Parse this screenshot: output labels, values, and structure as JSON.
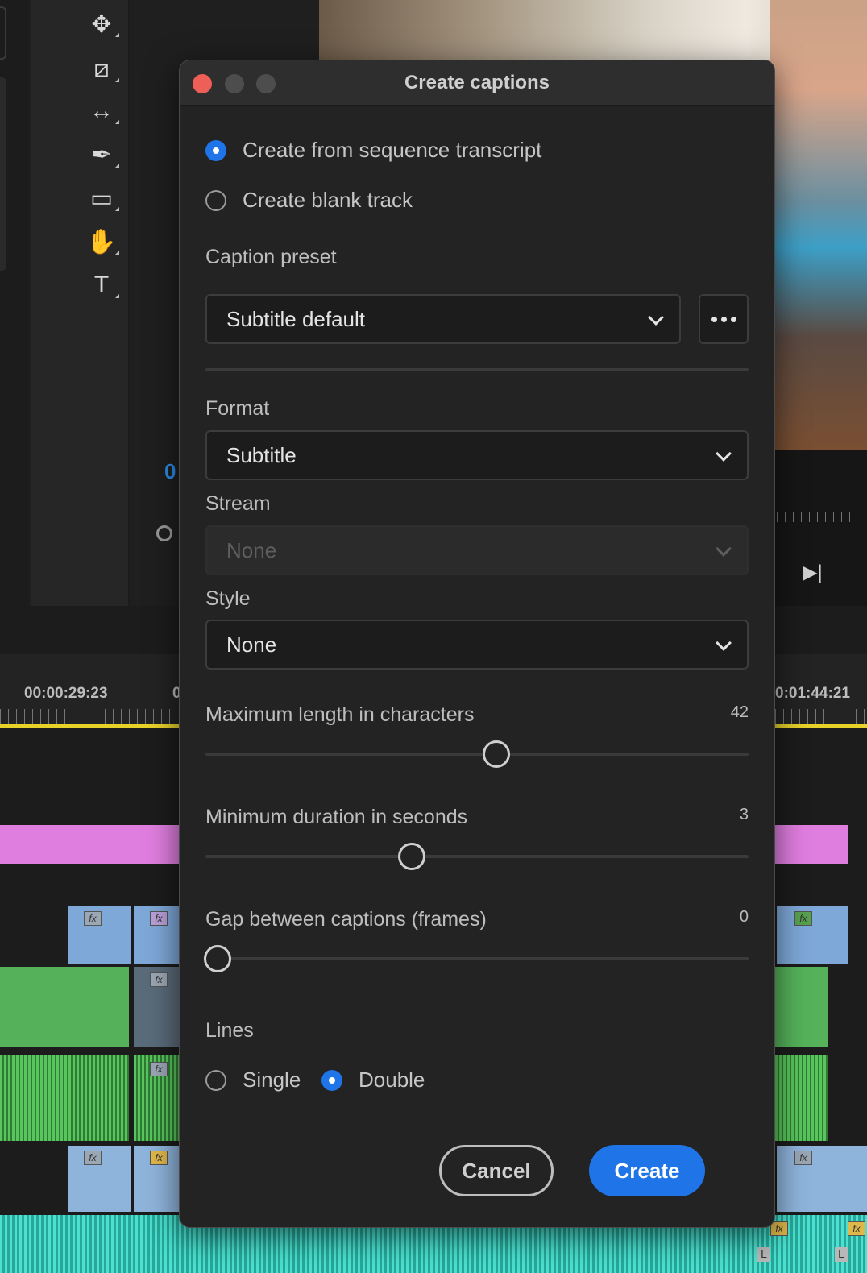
{
  "background": {
    "tools": [
      "move-tool-icon",
      "razor-tool-icon",
      "slip-tool-icon",
      "pen-tool-icon",
      "rectangle-tool-icon",
      "hand-tool-icon",
      "type-tool-icon"
    ],
    "playhead_digit": "0",
    "timecode_left": "00:00:29:23",
    "timecode_right": "0:01:44:21",
    "timecode_partial": "0"
  },
  "dialog": {
    "title": "Create captions",
    "source_options": [
      {
        "label": "Create from sequence transcript",
        "selected": true
      },
      {
        "label": "Create blank track",
        "selected": false
      }
    ],
    "caption_preset": {
      "label": "Caption preset",
      "value": "Subtitle default"
    },
    "format": {
      "label": "Format",
      "value": "Subtitle"
    },
    "stream": {
      "label": "Stream",
      "value": "None",
      "disabled": true
    },
    "style": {
      "label": "Style",
      "value": "None"
    },
    "sliders": [
      {
        "label": "Maximum length in characters",
        "value": "42"
      },
      {
        "label": "Minimum duration in seconds",
        "value": "3"
      },
      {
        "label": "Gap between captions (frames)",
        "value": "0"
      }
    ],
    "lines": {
      "label": "Lines",
      "options": [
        {
          "label": "Single",
          "selected": false
        },
        {
          "label": "Double",
          "selected": true
        }
      ]
    },
    "buttons": {
      "cancel": "Cancel",
      "create": "Create"
    },
    "accent_color": "#1f74e8"
  }
}
